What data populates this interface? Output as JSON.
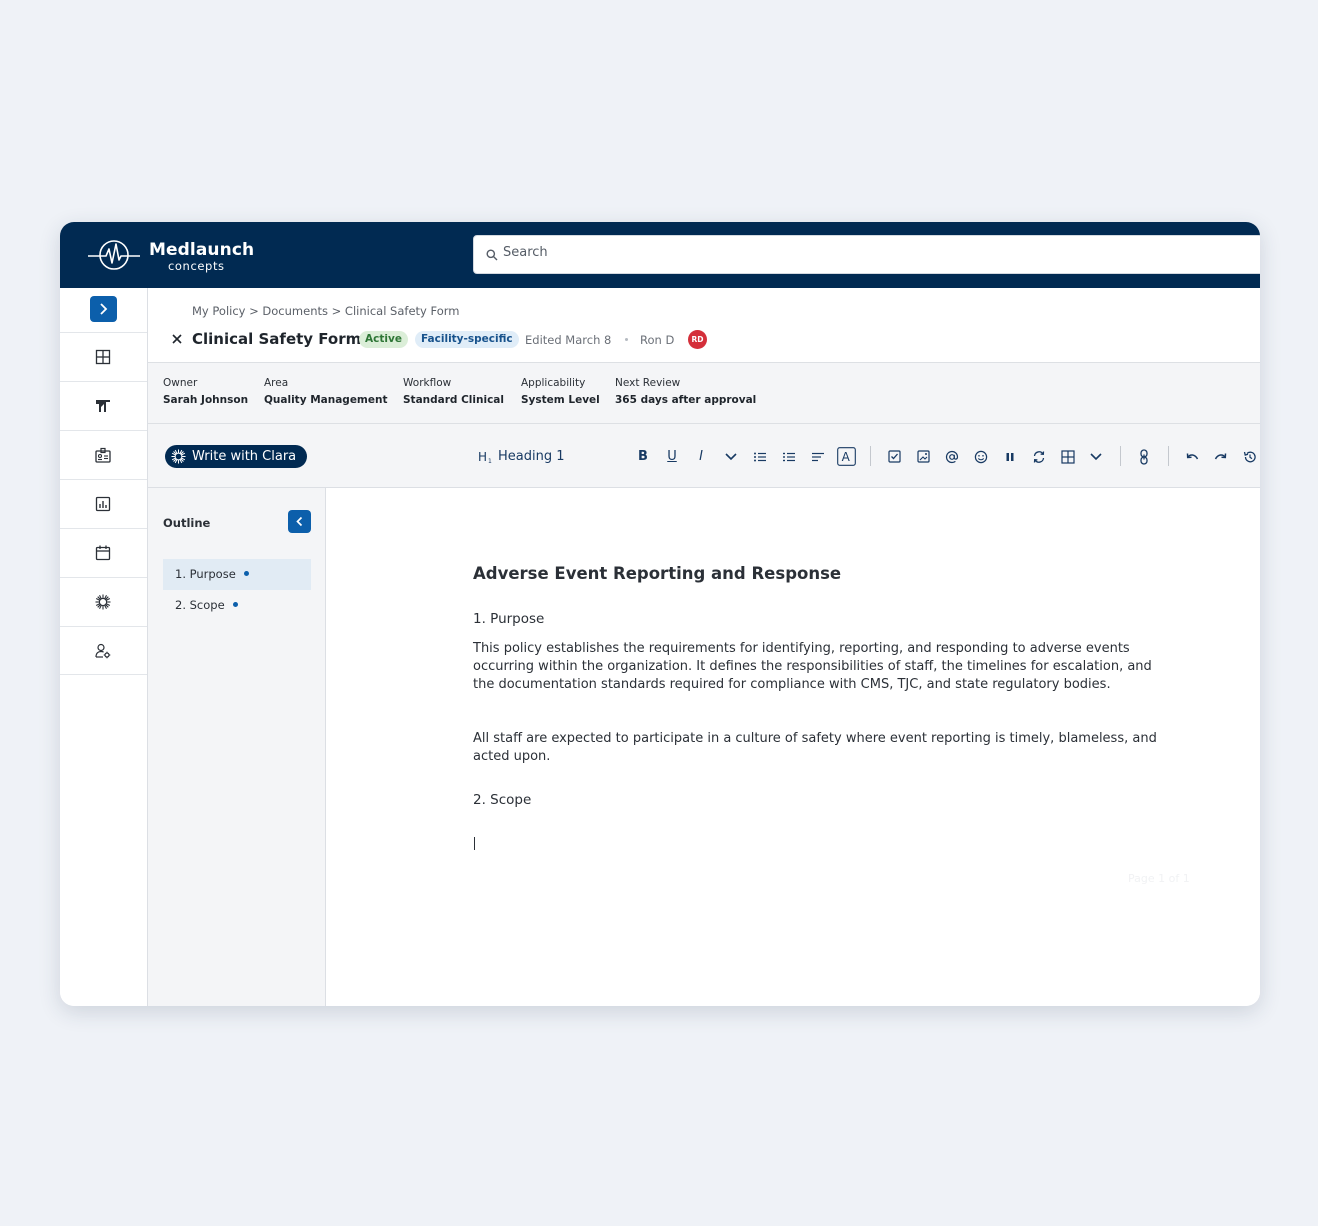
{
  "app": {
    "brand_name": "Medlaunch",
    "brand_sub": "concepts"
  },
  "search": {
    "placeholder": "Search"
  },
  "nav": {
    "items": [
      "dashboard-icon",
      "analytics-icon",
      "id-card-icon",
      "reports-icon",
      "calendar-icon",
      "sparkle-icon",
      "user-settings-icon"
    ]
  },
  "document": {
    "breadcrumb": "My Policy > Documents > Clinical Safety Form",
    "title": "Clinical Safety Form",
    "status_badge": "Active",
    "scope_badge": "Facility-specific",
    "edited": "Edited March 8",
    "author": "Ron D",
    "author_initials": "RD"
  },
  "meta": {
    "owner_label": "Owner",
    "owner_value": "Sarah Johnson",
    "area_label": "Area",
    "area_value": "Quality Management",
    "workflow_label": "Workflow",
    "workflow_value": "Standard Clinical",
    "applicability_label": "Applicability",
    "applicability_value": "System Level",
    "review_label": "Next Review",
    "review_value": "365 days after approval"
  },
  "toolbar": {
    "clara_label": "Write with Clara",
    "heading_select": "Heading 1",
    "bold": "B",
    "underline": "U",
    "italic": "I"
  },
  "outline": {
    "title": "Outline",
    "items": [
      "1. Purpose",
      "2. Scope"
    ]
  },
  "editor": {
    "title": "Adverse Event Reporting and Response",
    "section1_heading": "1. Purpose",
    "para1": "This policy establishes the requirements for identifying, reporting, and responding to adverse events occurring within the organization. It defines the responsibilities of staff, the timelines for escalation, and the documentation standards required for compliance with CMS, TJC, and state regulatory bodies.",
    "para2": "All staff are expected to participate in a culture of safety where event reporting is timely, blameless, and acted upon.",
    "section2_heading": "2. Scope",
    "page_indicator": "Page 1 of 1"
  },
  "colors": {
    "header_bg": "#012a52",
    "accent_blue": "#0c5fab",
    "active_badge_bg": "#dbeed8",
    "avatar_red": "#d42f3a"
  }
}
